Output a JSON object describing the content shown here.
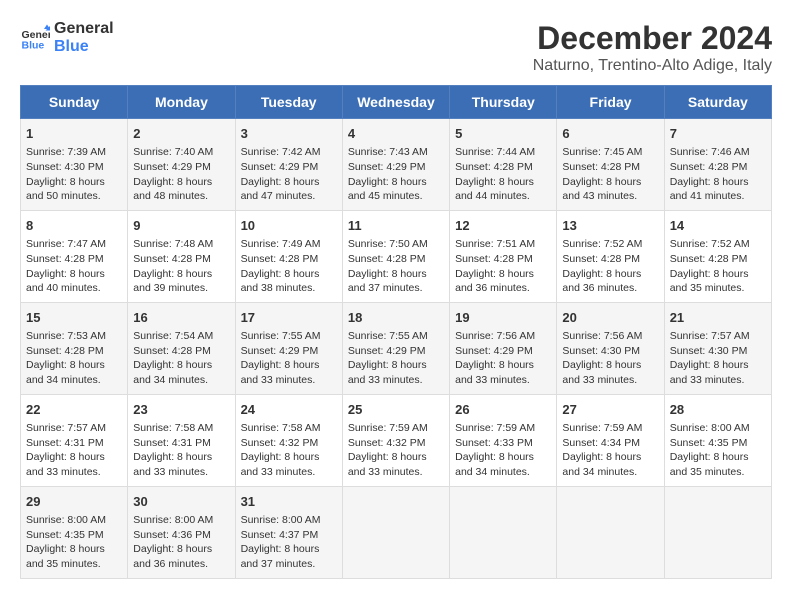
{
  "logo": {
    "line1": "General",
    "line2": "Blue"
  },
  "title": "December 2024",
  "subtitle": "Naturno, Trentino-Alto Adige, Italy",
  "days_header": [
    "Sunday",
    "Monday",
    "Tuesday",
    "Wednesday",
    "Thursday",
    "Friday",
    "Saturday"
  ],
  "weeks": [
    [
      {
        "day": "1",
        "sunrise": "Sunrise: 7:39 AM",
        "sunset": "Sunset: 4:30 PM",
        "daylight": "Daylight: 8 hours and 50 minutes."
      },
      {
        "day": "2",
        "sunrise": "Sunrise: 7:40 AM",
        "sunset": "Sunset: 4:29 PM",
        "daylight": "Daylight: 8 hours and 48 minutes."
      },
      {
        "day": "3",
        "sunrise": "Sunrise: 7:42 AM",
        "sunset": "Sunset: 4:29 PM",
        "daylight": "Daylight: 8 hours and 47 minutes."
      },
      {
        "day": "4",
        "sunrise": "Sunrise: 7:43 AM",
        "sunset": "Sunset: 4:29 PM",
        "daylight": "Daylight: 8 hours and 45 minutes."
      },
      {
        "day": "5",
        "sunrise": "Sunrise: 7:44 AM",
        "sunset": "Sunset: 4:28 PM",
        "daylight": "Daylight: 8 hours and 44 minutes."
      },
      {
        "day": "6",
        "sunrise": "Sunrise: 7:45 AM",
        "sunset": "Sunset: 4:28 PM",
        "daylight": "Daylight: 8 hours and 43 minutes."
      },
      {
        "day": "7",
        "sunrise": "Sunrise: 7:46 AM",
        "sunset": "Sunset: 4:28 PM",
        "daylight": "Daylight: 8 hours and 41 minutes."
      }
    ],
    [
      {
        "day": "8",
        "sunrise": "Sunrise: 7:47 AM",
        "sunset": "Sunset: 4:28 PM",
        "daylight": "Daylight: 8 hours and 40 minutes."
      },
      {
        "day": "9",
        "sunrise": "Sunrise: 7:48 AM",
        "sunset": "Sunset: 4:28 PM",
        "daylight": "Daylight: 8 hours and 39 minutes."
      },
      {
        "day": "10",
        "sunrise": "Sunrise: 7:49 AM",
        "sunset": "Sunset: 4:28 PM",
        "daylight": "Daylight: 8 hours and 38 minutes."
      },
      {
        "day": "11",
        "sunrise": "Sunrise: 7:50 AM",
        "sunset": "Sunset: 4:28 PM",
        "daylight": "Daylight: 8 hours and 37 minutes."
      },
      {
        "day": "12",
        "sunrise": "Sunrise: 7:51 AM",
        "sunset": "Sunset: 4:28 PM",
        "daylight": "Daylight: 8 hours and 36 minutes."
      },
      {
        "day": "13",
        "sunrise": "Sunrise: 7:52 AM",
        "sunset": "Sunset: 4:28 PM",
        "daylight": "Daylight: 8 hours and 36 minutes."
      },
      {
        "day": "14",
        "sunrise": "Sunrise: 7:52 AM",
        "sunset": "Sunset: 4:28 PM",
        "daylight": "Daylight: 8 hours and 35 minutes."
      }
    ],
    [
      {
        "day": "15",
        "sunrise": "Sunrise: 7:53 AM",
        "sunset": "Sunset: 4:28 PM",
        "daylight": "Daylight: 8 hours and 34 minutes."
      },
      {
        "day": "16",
        "sunrise": "Sunrise: 7:54 AM",
        "sunset": "Sunset: 4:28 PM",
        "daylight": "Daylight: 8 hours and 34 minutes."
      },
      {
        "day": "17",
        "sunrise": "Sunrise: 7:55 AM",
        "sunset": "Sunset: 4:29 PM",
        "daylight": "Daylight: 8 hours and 33 minutes."
      },
      {
        "day": "18",
        "sunrise": "Sunrise: 7:55 AM",
        "sunset": "Sunset: 4:29 PM",
        "daylight": "Daylight: 8 hours and 33 minutes."
      },
      {
        "day": "19",
        "sunrise": "Sunrise: 7:56 AM",
        "sunset": "Sunset: 4:29 PM",
        "daylight": "Daylight: 8 hours and 33 minutes."
      },
      {
        "day": "20",
        "sunrise": "Sunrise: 7:56 AM",
        "sunset": "Sunset: 4:30 PM",
        "daylight": "Daylight: 8 hours and 33 minutes."
      },
      {
        "day": "21",
        "sunrise": "Sunrise: 7:57 AM",
        "sunset": "Sunset: 4:30 PM",
        "daylight": "Daylight: 8 hours and 33 minutes."
      }
    ],
    [
      {
        "day": "22",
        "sunrise": "Sunrise: 7:57 AM",
        "sunset": "Sunset: 4:31 PM",
        "daylight": "Daylight: 8 hours and 33 minutes."
      },
      {
        "day": "23",
        "sunrise": "Sunrise: 7:58 AM",
        "sunset": "Sunset: 4:31 PM",
        "daylight": "Daylight: 8 hours and 33 minutes."
      },
      {
        "day": "24",
        "sunrise": "Sunrise: 7:58 AM",
        "sunset": "Sunset: 4:32 PM",
        "daylight": "Daylight: 8 hours and 33 minutes."
      },
      {
        "day": "25",
        "sunrise": "Sunrise: 7:59 AM",
        "sunset": "Sunset: 4:32 PM",
        "daylight": "Daylight: 8 hours and 33 minutes."
      },
      {
        "day": "26",
        "sunrise": "Sunrise: 7:59 AM",
        "sunset": "Sunset: 4:33 PM",
        "daylight": "Daylight: 8 hours and 34 minutes."
      },
      {
        "day": "27",
        "sunrise": "Sunrise: 7:59 AM",
        "sunset": "Sunset: 4:34 PM",
        "daylight": "Daylight: 8 hours and 34 minutes."
      },
      {
        "day": "28",
        "sunrise": "Sunrise: 8:00 AM",
        "sunset": "Sunset: 4:35 PM",
        "daylight": "Daylight: 8 hours and 35 minutes."
      }
    ],
    [
      {
        "day": "29",
        "sunrise": "Sunrise: 8:00 AM",
        "sunset": "Sunset: 4:35 PM",
        "daylight": "Daylight: 8 hours and 35 minutes."
      },
      {
        "day": "30",
        "sunrise": "Sunrise: 8:00 AM",
        "sunset": "Sunset: 4:36 PM",
        "daylight": "Daylight: 8 hours and 36 minutes."
      },
      {
        "day": "31",
        "sunrise": "Sunrise: 8:00 AM",
        "sunset": "Sunset: 4:37 PM",
        "daylight": "Daylight: 8 hours and 37 minutes."
      },
      null,
      null,
      null,
      null
    ]
  ]
}
